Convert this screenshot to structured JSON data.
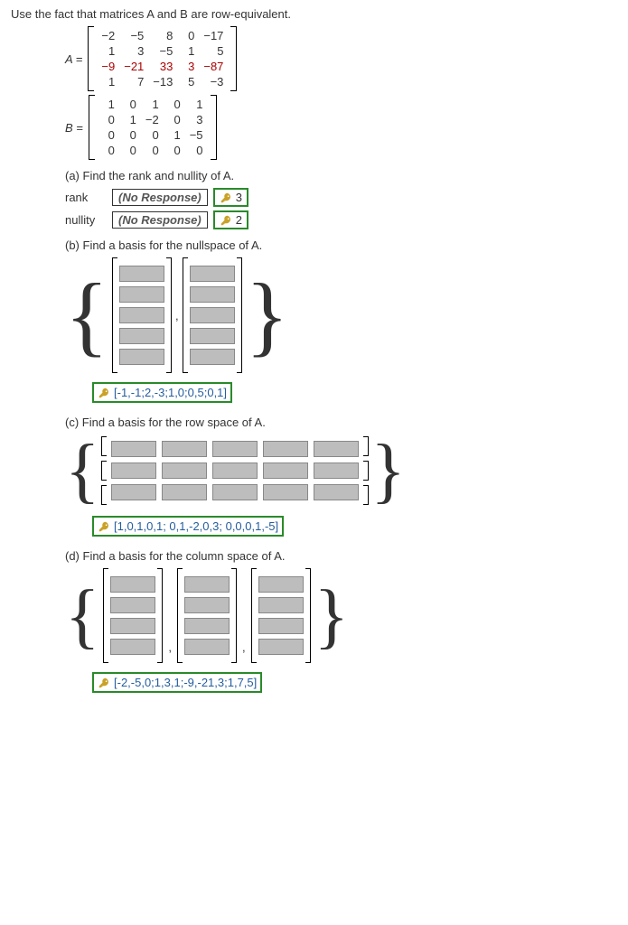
{
  "instruction": "Use the fact that matrices A and B are row-equivalent.",
  "matrixA": {
    "label": "A =",
    "rows": [
      [
        "−2",
        "−5",
        "8",
        "0",
        "−17"
      ],
      [
        "1",
        "3",
        "−5",
        "1",
        "5"
      ],
      [
        "−9",
        "−21",
        "33",
        "3",
        "−87"
      ],
      [
        "1",
        "7",
        "−13",
        "5",
        "−3"
      ]
    ]
  },
  "matrixB": {
    "label": "B =",
    "rows": [
      [
        "1",
        "0",
        "1",
        "0",
        "1"
      ],
      [
        "0",
        "1",
        "−2",
        "0",
        "3"
      ],
      [
        "0",
        "0",
        "0",
        "1",
        "−5"
      ],
      [
        "0",
        "0",
        "0",
        "0",
        "0"
      ]
    ]
  },
  "parts": {
    "a": {
      "prompt": "(a) Find the rank and nullity of A.",
      "rankLabel": "rank",
      "nullityLabel": "nullity",
      "noResponse": "(No Response)",
      "rank": "3",
      "nullity": "2"
    },
    "b": {
      "prompt": "(b) Find a basis for the nullspace of A.",
      "answer": "[-1,-1;2,-3;1,0;0,5;0,1]"
    },
    "c": {
      "prompt": "(c) Find a basis for the row space of A.",
      "answer": "[1,0,1,0,1; 0,1,-2,0,3; 0,0,0,1,-5]"
    },
    "d": {
      "prompt": "(d) Find a basis for the column space of A.",
      "answer": "[-2,-5,0;1,3,1;-9,-21,3;1,7,5]"
    }
  }
}
